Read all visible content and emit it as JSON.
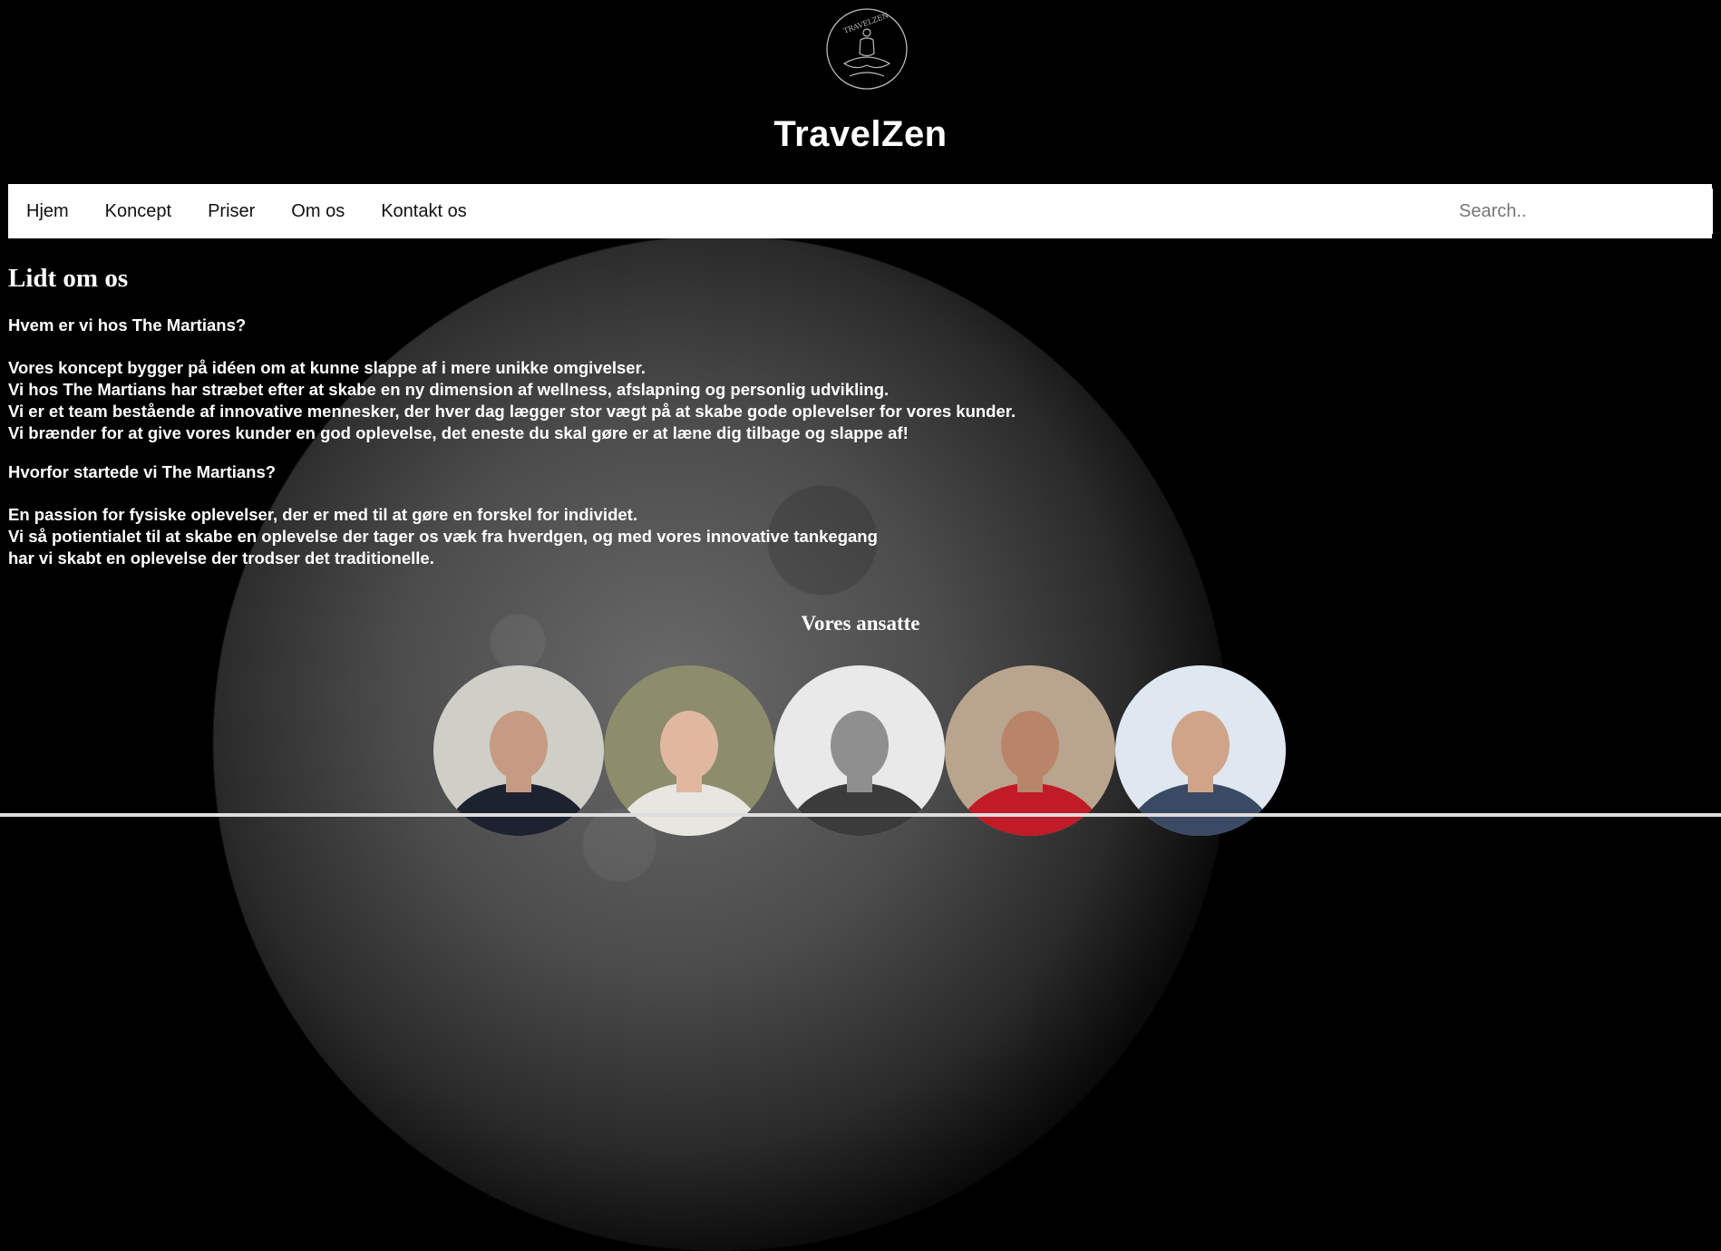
{
  "brand": {
    "logo_text": "TRAVELZEN",
    "title": "TravelZen"
  },
  "nav": {
    "items": [
      {
        "label": "Hjem"
      },
      {
        "label": "Koncept"
      },
      {
        "label": "Priser"
      },
      {
        "label": "Om os"
      },
      {
        "label": "Kontakt os"
      }
    ],
    "search_placeholder": "Search.."
  },
  "main": {
    "title": "Lidt om os",
    "q1": "Hvem er vi hos The Martians?",
    "para1": [
      "Vores koncept bygger på idéen om at kunne slappe af i mere unikke omgivelser.",
      "Vi hos The Martians har stræbet efter at skabe en ny dimension af wellness, afslapning og personlig udvikling.",
      "Vi er et team bestående af innovative mennesker, der hver dag lægger stor vægt på at skabe gode oplevelser for vores kunder.",
      "Vi brænder for at give vores kunder en god oplevelse, det eneste du skal gøre er at læne dig tilbage og slappe af!"
    ],
    "q2": "Hvorfor startede vi The Martians?",
    "para2": [
      "En passion for fysiske oplevelser, der er med til at gøre en forskel for individet.",
      "Vi så potientialet til at skabe en oplevelse der tager os væk fra hverdgen, og med vores innovative tankegang",
      "har vi skabt en oplevelse der trodser det traditionelle."
    ]
  },
  "staff": {
    "title": "Vores ansatte",
    "members": [
      {
        "photo": "staff-photo-1",
        "bg": "#cfcfc8",
        "shirt": "#1d2230",
        "skin": "#c79a82"
      },
      {
        "photo": "staff-photo-2",
        "bg": "#8d8c6c",
        "shirt": "#e8e6e0",
        "skin": "#e0b8a0"
      },
      {
        "photo": "staff-photo-3",
        "bg": "#e9e9e9",
        "shirt": "#3b3b3b",
        "skin": "#8f8f8f"
      },
      {
        "photo": "staff-photo-4",
        "bg": "#b9a58e",
        "shirt": "#c01b26",
        "skin": "#b8846a"
      },
      {
        "photo": "staff-photo-5",
        "bg": "#dfe8f0",
        "shirt": "#3a4a64",
        "skin": "#d0a488"
      }
    ]
  },
  "colors": {
    "background": "#000000",
    "navbar": "#ffffff",
    "text": "#ffffff",
    "nav_text": "#111111"
  }
}
